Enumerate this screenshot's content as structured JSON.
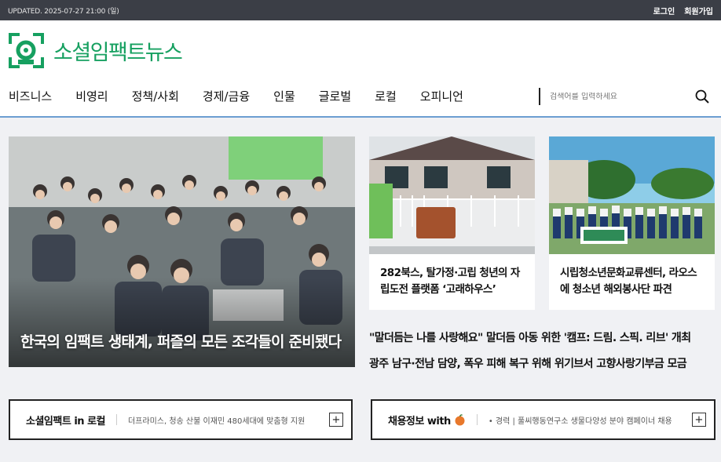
{
  "topbar": {
    "updated": "UPDATED. 2025-07-27 21:00 (일)",
    "login": "로그인",
    "signup": "회원가입"
  },
  "logo": {
    "text": "소셜임팩트뉴스"
  },
  "nav": {
    "items": [
      "비즈니스",
      "비영리",
      "정책/사회",
      "경제/금융",
      "인물",
      "글로벌",
      "로컬",
      "오피니언"
    ]
  },
  "search": {
    "placeholder": "검색어를 입력하세요"
  },
  "hero": {
    "title": "한국의 임팩트 생태계, 퍼즐의 모든 조각들이 준비됐다"
  },
  "cards": [
    {
      "title": "282북스, 탈가정·고립 청년의 자립도전 플랫폼 ‘고래하우스’"
    },
    {
      "title": "시립청소년문화교류센터, 라오스에 청소년 해외봉사단 파견"
    }
  ],
  "headlines": [
    "\"말더듬는 나를 사랑해요\" 말더듬 아동 위한 '캠프: 드림. 스픽. 리브' 개최",
    "광주 남구·전남 담양, 폭우 피해 복구 위해 위기브서 고향사랑기부금 모금"
  ],
  "boxes": {
    "local": {
      "title": "소셜임팩트 in 로컬",
      "text": "더프라미스, 청송 산불 이재민 480세대에 맞춤형 지원"
    },
    "jobs": {
      "title": "채용정보 with",
      "text": "• 경력 | 풀씨행동연구소 생물다양성 분야 캠페이너 채용"
    }
  },
  "colors": {
    "brand": "#16a060",
    "topbar": "#3b3e46",
    "header_border": "#6c9ed1",
    "orange": "#e8782b"
  }
}
